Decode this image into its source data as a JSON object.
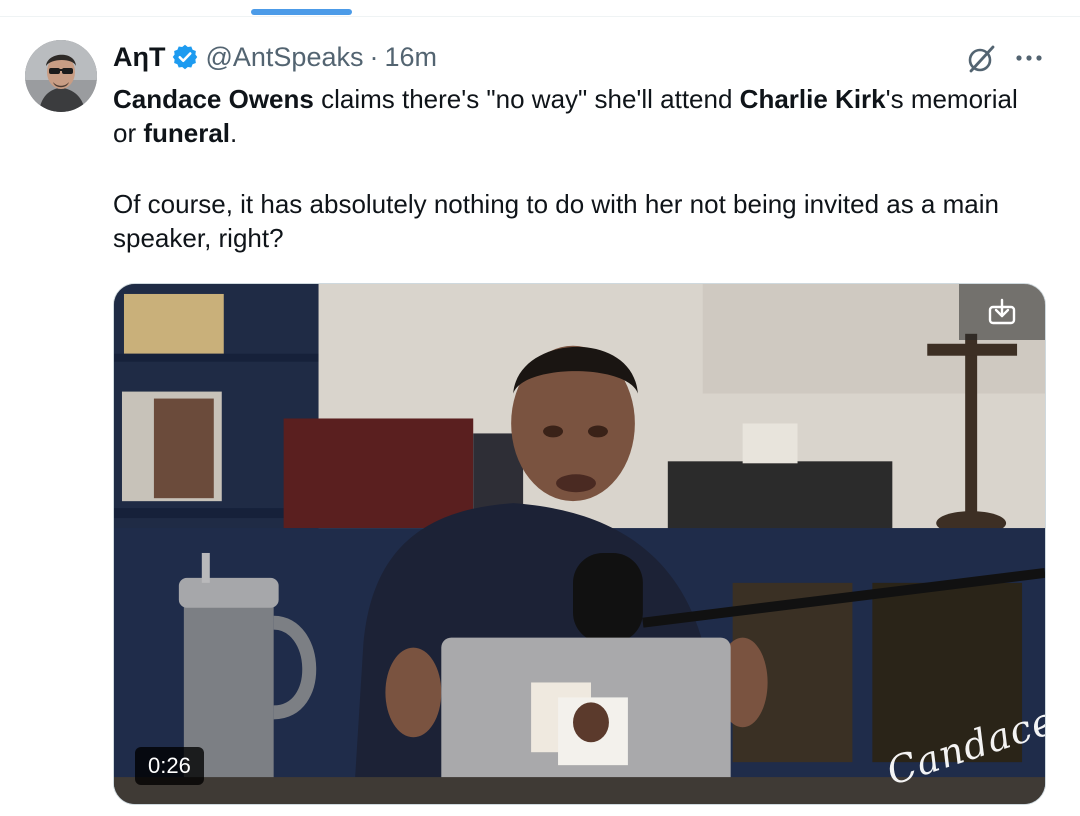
{
  "tweet": {
    "display_name": "AηT",
    "handle": "@AntSpeaks",
    "separator": "·",
    "time": "16m",
    "text_p1": {
      "s1_bold": "Candace Owens",
      "s2": " claims there's \"no way\" she'll attend ",
      "s3_bold": "Charlie Kirk",
      "s4": "'s memorial or ",
      "s5_bold": "funeral",
      "s6": "."
    },
    "text_p2": "Of course, it has absolutely nothing to do with her not being invited as a main speaker, right?"
  },
  "media": {
    "duration": "0:26",
    "watermark": "Candace",
    "download_icon": "download-icon"
  },
  "icons": {
    "verified": "verified-badge-icon",
    "grok": "grok-icon",
    "more": "more-options-icon"
  },
  "colors": {
    "verified": "#1d9bf0",
    "secondary_text": "#536471",
    "indicator": "#4c9be8"
  }
}
